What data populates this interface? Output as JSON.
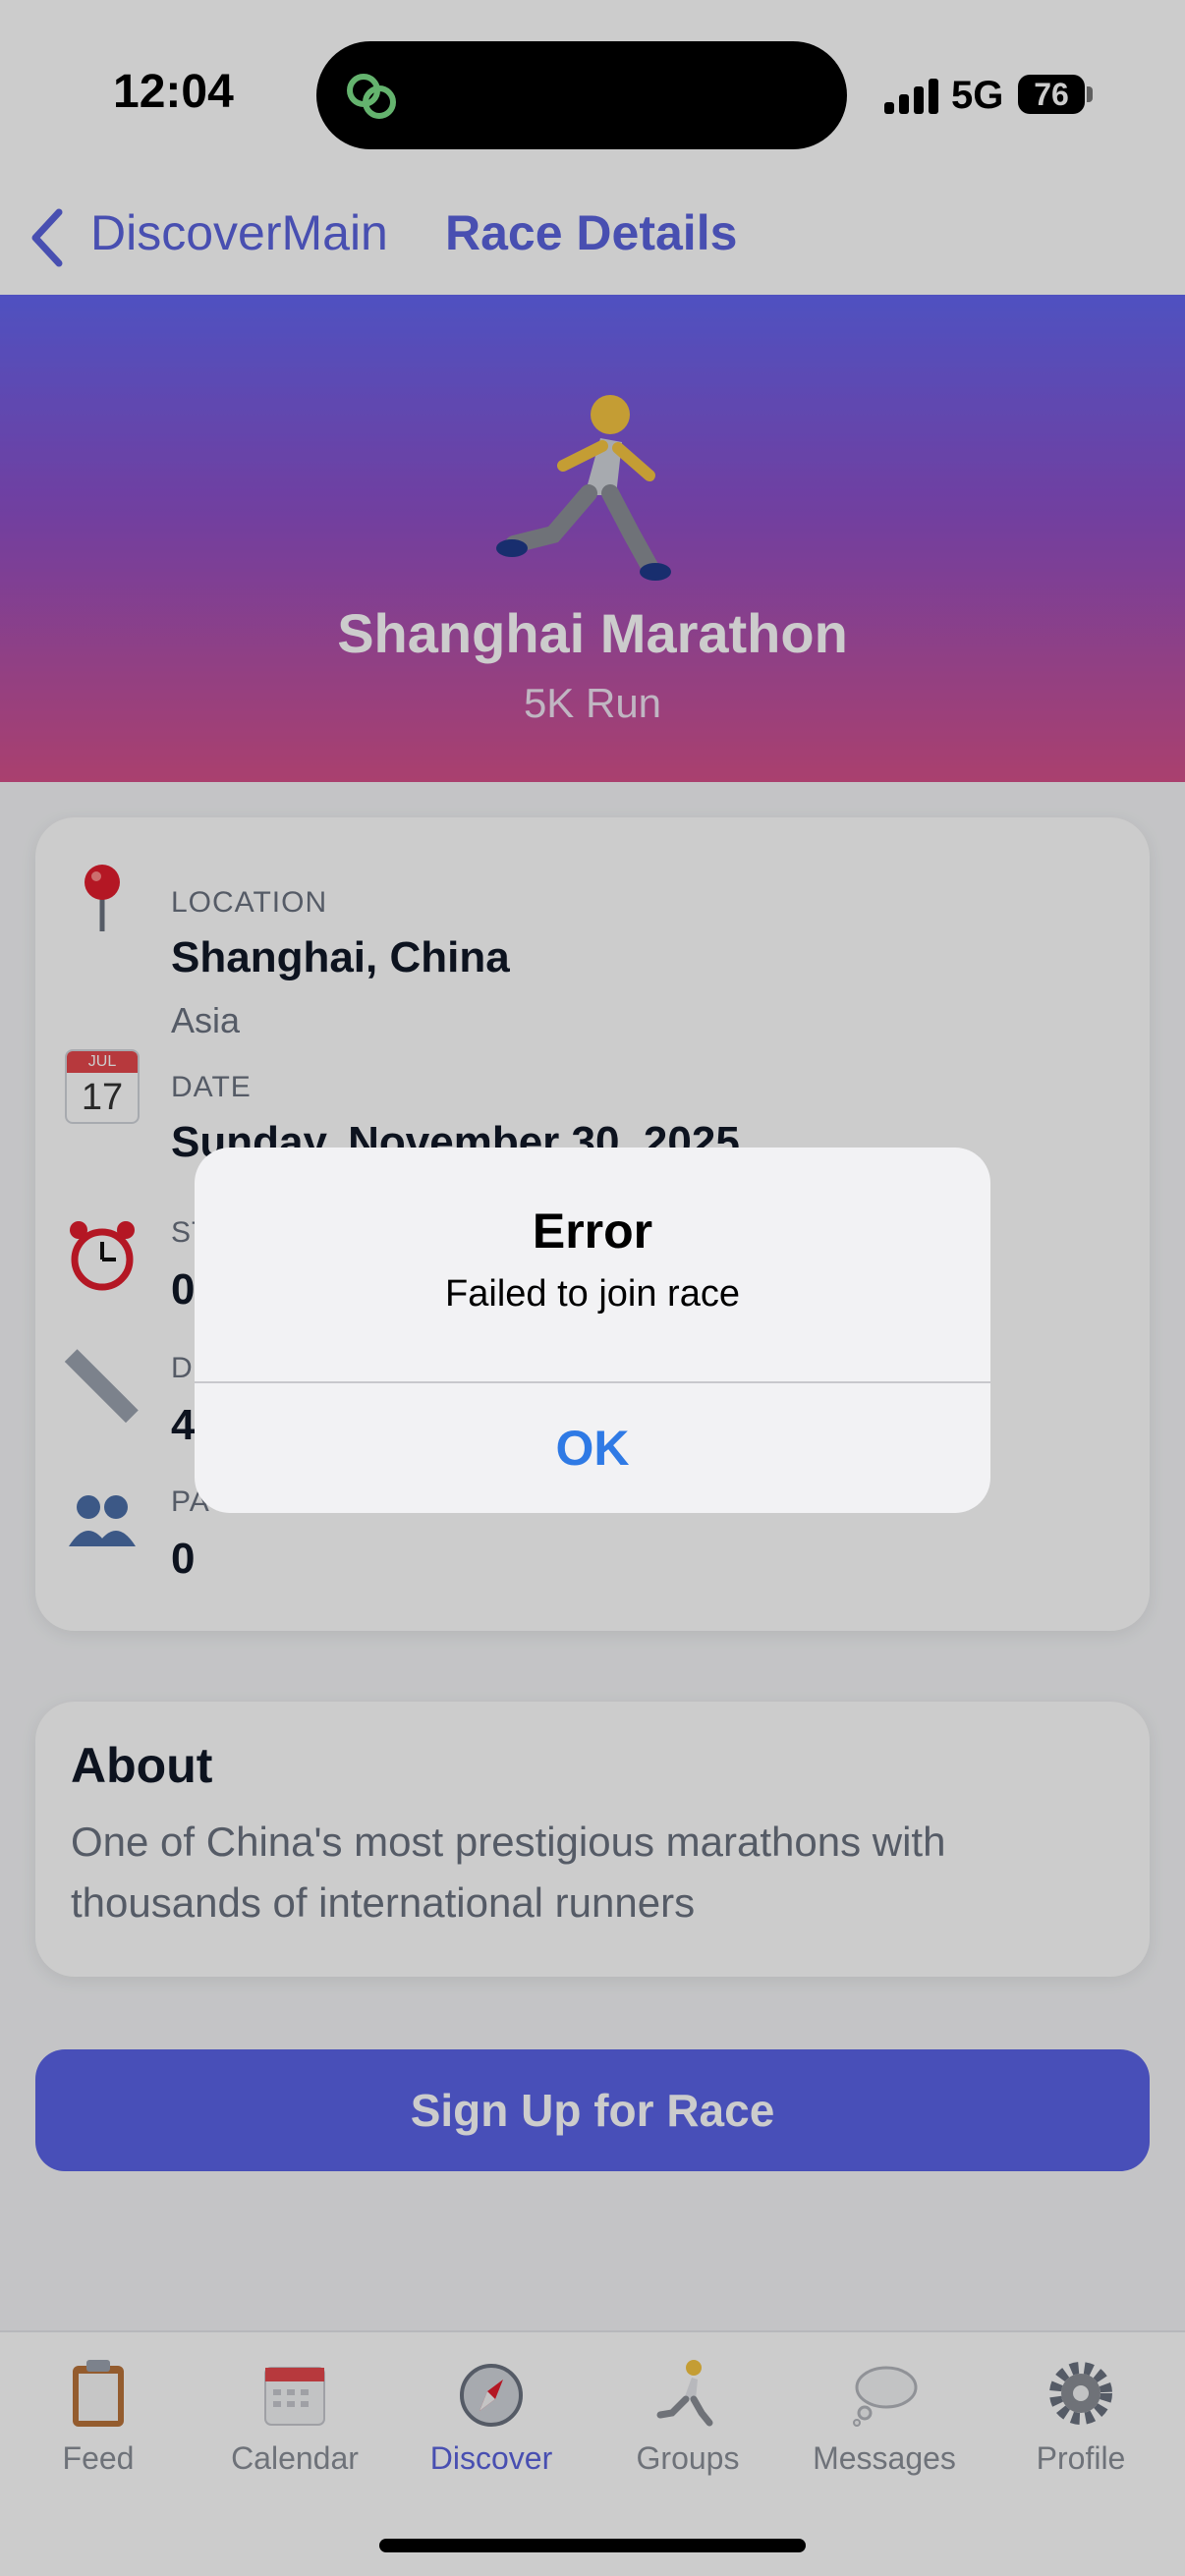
{
  "status_bar": {
    "time": "12:04",
    "network": "5G",
    "battery": "76"
  },
  "nav": {
    "back_label": "DiscoverMain",
    "title": "Race Details"
  },
  "hero": {
    "emoji": "🏃",
    "title": "Shanghai Marathon",
    "subtitle": "5K Run"
  },
  "details": {
    "location": {
      "label": "LOCATION",
      "value": "Shanghai, China",
      "sub": "Asia"
    },
    "date": {
      "label": "DATE",
      "value": "Sunday, November 30, 2025",
      "icon_day": "17",
      "icon_month": "JUL"
    },
    "start": {
      "label": "ST",
      "value": "0"
    },
    "distance": {
      "label": "D",
      "value": "4"
    },
    "participants": {
      "label": "PA",
      "value": "0"
    }
  },
  "about": {
    "title": "About",
    "text": "One of China's most prestigious marathons with thousands of international runners"
  },
  "signup_label": "Sign Up for Race",
  "tabs": [
    {
      "label": "Feed",
      "icon": "clipboard-icon"
    },
    {
      "label": "Calendar",
      "icon": "calendar-icon"
    },
    {
      "label": "Discover",
      "icon": "compass-icon",
      "active": true
    },
    {
      "label": "Groups",
      "icon": "runner-icon"
    },
    {
      "label": "Messages",
      "icon": "thought-bubble-icon"
    },
    {
      "label": "Profile",
      "icon": "gear-icon"
    }
  ],
  "alert": {
    "title": "Error",
    "message": "Failed to join race",
    "ok_label": "OK"
  },
  "colors": {
    "accent": "#5b63de",
    "alert_button": "#2f7ae5",
    "hero_top": "#6366f1",
    "hero_bottom": "#d5508a"
  }
}
